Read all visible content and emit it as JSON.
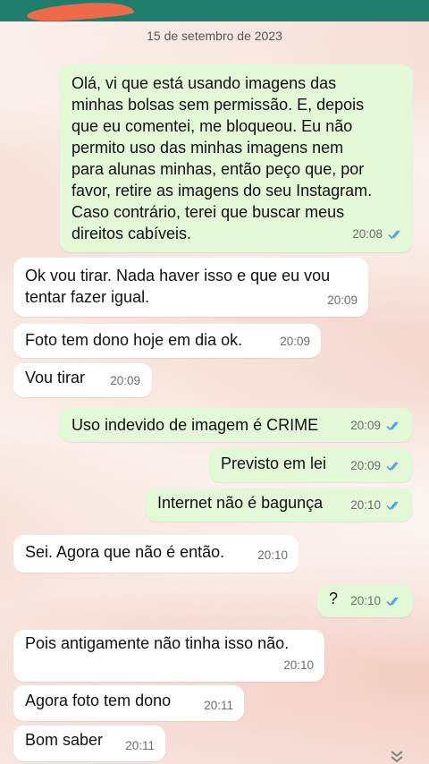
{
  "conversation": {
    "date_label": "15 de setembro de 2023",
    "messages": [
      {
        "dir": "out",
        "text": "Olá, vi que está usando imagens das\nminhas bolsas sem permissão. E, depois\nque eu comentei, me bloqueou. Eu não\npermito uso das minhas imagens nem\npara alunas minhas, então peço que, por\nfavor, retire as imagens do seu Instagram.\nCaso contrário, terei que buscar meus\ndireitos cabíveis.",
        "time": "20:08",
        "status": "read"
      },
      {
        "dir": "in",
        "text": "Ok vou tirar. Nada haver isso e que eu vou\ntentar fazer igual.",
        "time": "20:09"
      },
      {
        "dir": "in",
        "text": "Foto tem dono hoje em dia ok.",
        "time": "20:09"
      },
      {
        "dir": "in",
        "text": "Vou tirar",
        "time": "20:09"
      },
      {
        "dir": "out",
        "text": "Uso indevido de imagem é CRIME",
        "time": "20:09",
        "status": "read"
      },
      {
        "dir": "out",
        "text": "Previsto em lei",
        "time": "20:09",
        "status": "read"
      },
      {
        "dir": "out",
        "text": "Internet não é bagunça",
        "time": "20:10",
        "status": "read"
      },
      {
        "dir": "in",
        "text": "Sei. Agora que não é então.",
        "time": "20:10"
      },
      {
        "dir": "out",
        "text": "?",
        "time": "20:10",
        "status": "read"
      },
      {
        "dir": "in",
        "text": "Pois antigamente não tinha isso não.",
        "time": "20:10"
      },
      {
        "dir": "in",
        "text": "Agora foto tem dono",
        "time": "20:11"
      },
      {
        "dir": "in",
        "text": "Bom saber",
        "time": "20:11"
      }
    ]
  },
  "icons": {
    "read_receipt": "double-check-icon",
    "scroll_down": "double-chevron-down-icon"
  },
  "colors": {
    "outgoing_bubble": "#e2f8d6",
    "incoming_bubble": "#ffffff",
    "read_tick": "#4fa3e0",
    "header": "#1f7d6c"
  }
}
